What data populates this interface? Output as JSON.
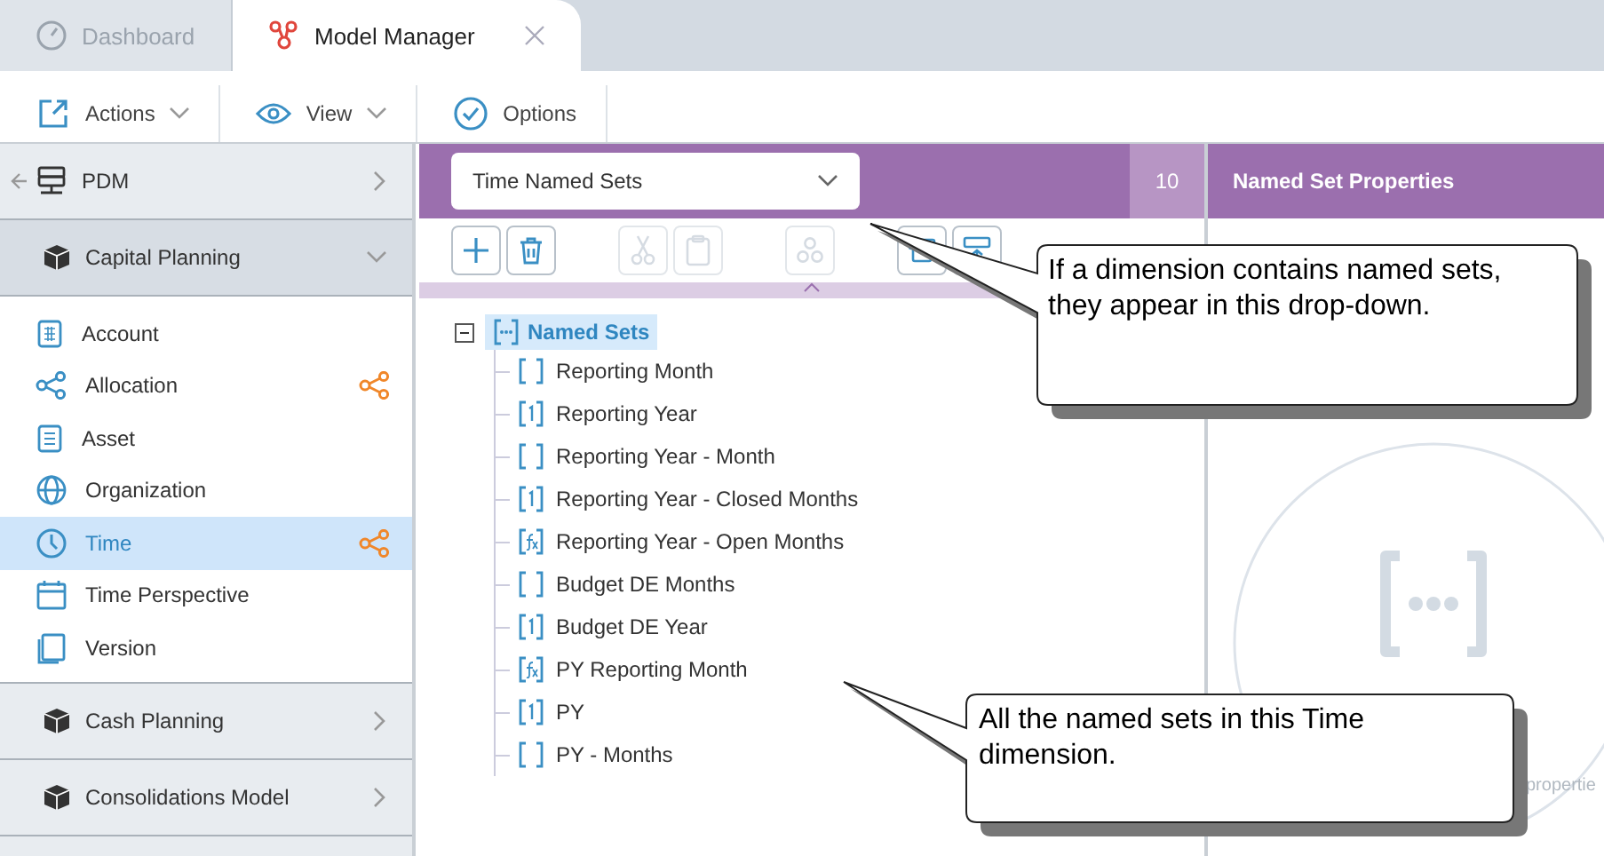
{
  "tabs": [
    {
      "label": "Dashboard",
      "selected": false,
      "closable": false
    },
    {
      "label": "Model Manager",
      "selected": true,
      "closable": true
    }
  ],
  "toolbar": [
    {
      "label": "Actions",
      "dropdown": true
    },
    {
      "label": "View",
      "dropdown": true
    },
    {
      "label": "Options",
      "dropdown": false
    }
  ],
  "sidebar": {
    "groups": [
      {
        "label": "PDM",
        "kind": "back",
        "expanded": false
      },
      {
        "label": "Capital Planning",
        "kind": "model",
        "expanded": true,
        "items": [
          {
            "label": "Account",
            "selected": false,
            "shared": false
          },
          {
            "label": "Allocation",
            "selected": false,
            "shared": true
          },
          {
            "label": "Asset",
            "selected": false,
            "shared": false
          },
          {
            "label": "Organization",
            "selected": false,
            "shared": false
          },
          {
            "label": "Time",
            "selected": true,
            "shared": true
          },
          {
            "label": "Time Perspective",
            "selected": false,
            "shared": false
          },
          {
            "label": "Version",
            "selected": false,
            "shared": false
          }
        ]
      },
      {
        "label": "Cash Planning",
        "kind": "model",
        "expanded": false
      },
      {
        "label": "Consolidations Model",
        "kind": "model",
        "expanded": false
      }
    ]
  },
  "center": {
    "dropdown": {
      "value": "Time Named Sets"
    },
    "count": "10",
    "tools": [
      {
        "disabled": false
      },
      {
        "disabled": false
      },
      {
        "disabled": true
      },
      {
        "disabled": true
      },
      {
        "disabled": true
      },
      {
        "disabled": false
      },
      {
        "disabled": false
      }
    ],
    "tree": {
      "label": "Named Sets",
      "selected": true,
      "expanded": true,
      "children": [
        {
          "label": "Reporting Month",
          "kind": "set"
        },
        {
          "label": "Reporting Year",
          "kind": "single"
        },
        {
          "label": "Reporting Year - Month",
          "kind": "set"
        },
        {
          "label": "Reporting Year - Closed Months",
          "kind": "single"
        },
        {
          "label": "Reporting Year - Open Months",
          "kind": "formula"
        },
        {
          "label": "Budget DE Months",
          "kind": "set"
        },
        {
          "label": "Budget DE Year",
          "kind": "single"
        },
        {
          "label": "PY Reporting Month",
          "kind": "formula"
        },
        {
          "label": "PY",
          "kind": "single"
        },
        {
          "label": "PY - Months",
          "kind": "set"
        }
      ]
    }
  },
  "properties": {
    "title": "Named Set Properties",
    "empty_text": "propertie"
  },
  "callouts": [
    {
      "text": "If a dimension contains named sets, they appear in this drop-down."
    },
    {
      "text": "All the named sets in this Time dimension."
    }
  ]
}
